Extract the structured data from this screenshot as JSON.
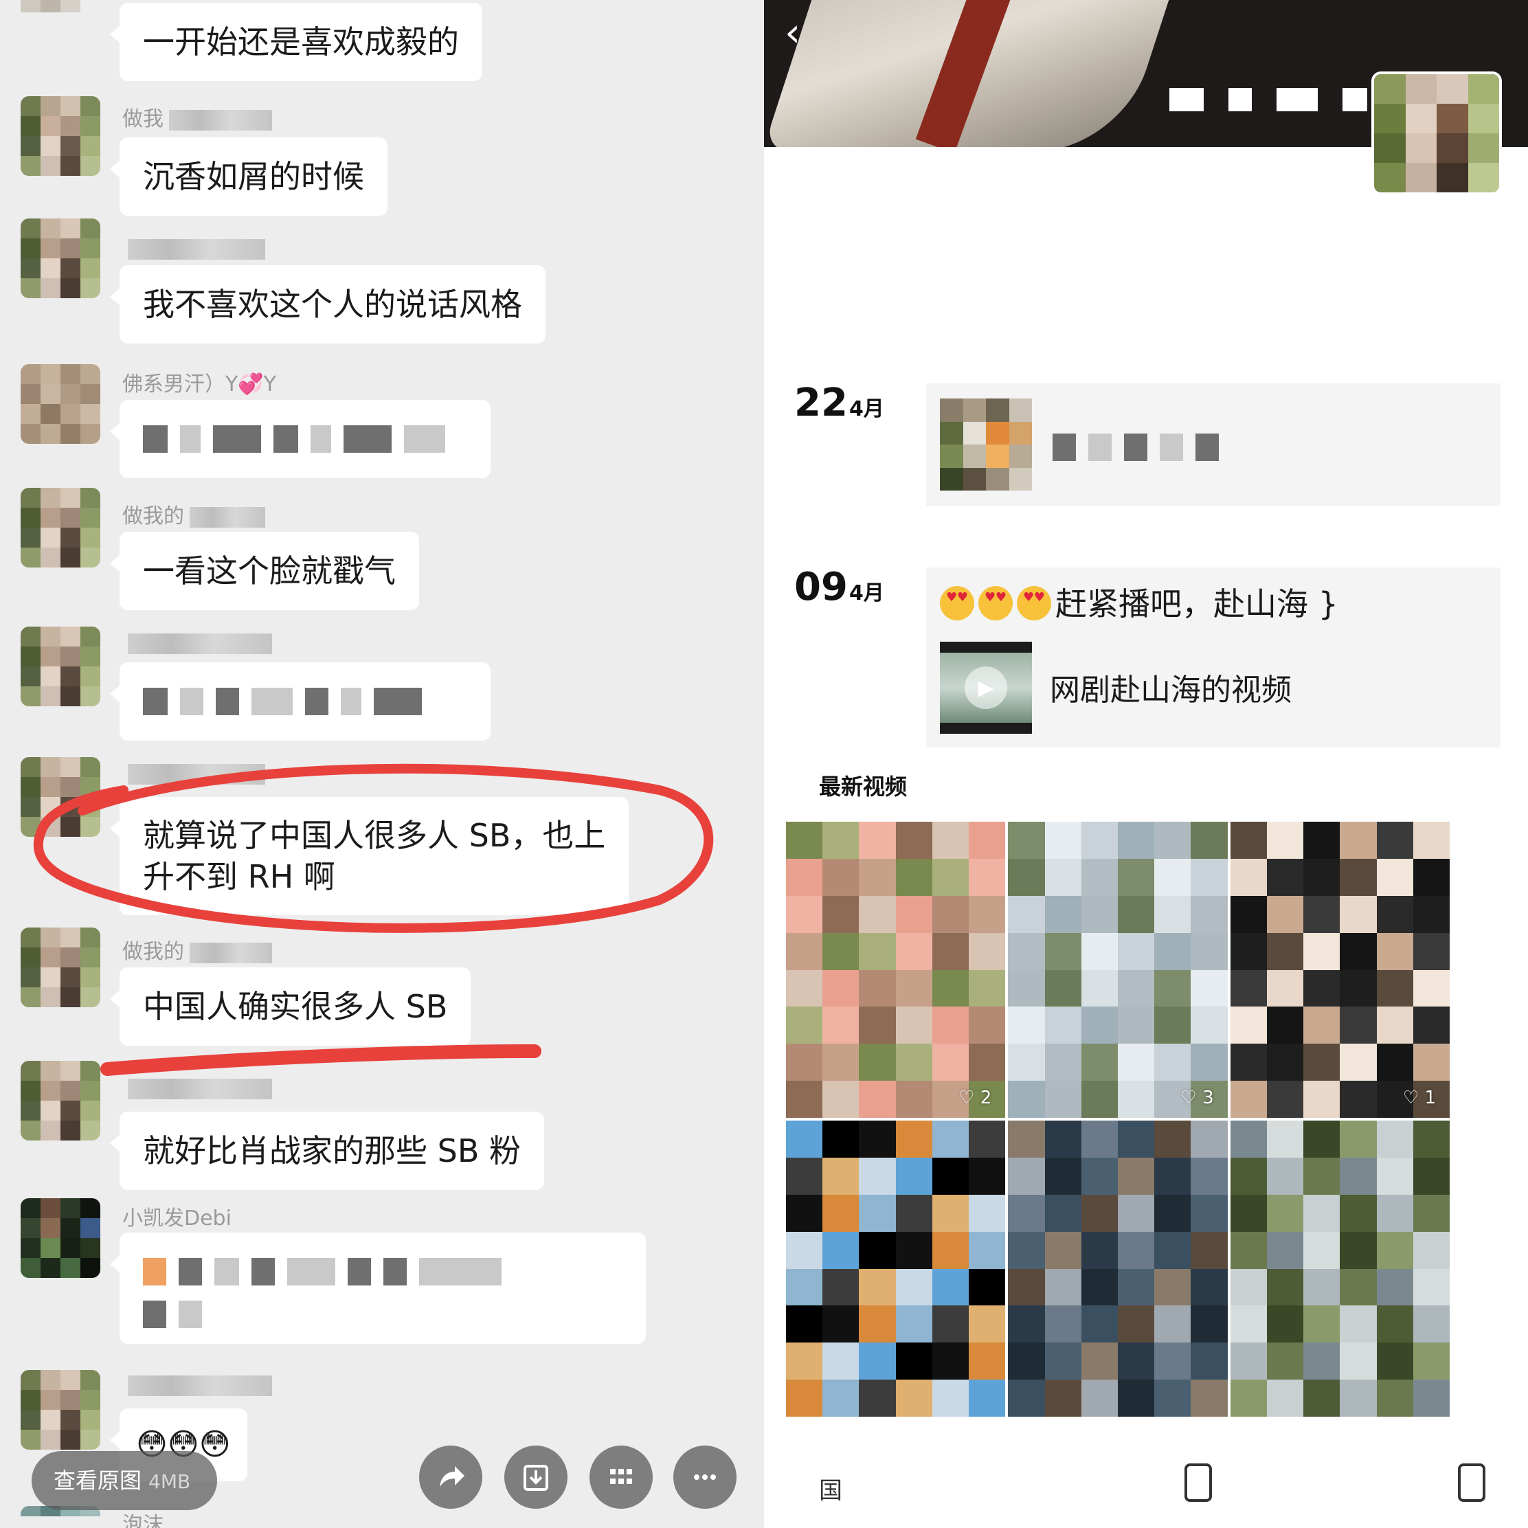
{
  "chat": {
    "messages": [
      {
        "id": "m1",
        "top": 0,
        "nickname": "",
        "text": "一开始还是喜欢成毅的"
      },
      {
        "id": "m2",
        "nickname": "做我",
        "text": "沉香如屑的时候"
      },
      {
        "id": "m3",
        "nickname": "",
        "text": "我不喜欢这个人的说话风格"
      },
      {
        "id": "m4",
        "nickname": "佛系男汗）Y💞Y",
        "text": ""
      },
      {
        "id": "m5",
        "nickname": "做我的",
        "text": "一看这个脸就戳气"
      },
      {
        "id": "m6",
        "nickname": "",
        "text": ""
      },
      {
        "id": "m7",
        "nickname": "",
        "text_line1": "就算说了中国人很多人 SB，也上",
        "text_line2": "升不到 RH 啊"
      },
      {
        "id": "m8",
        "nickname": "做我的",
        "text": "中国人确实很多人 SB"
      },
      {
        "id": "m9",
        "nickname": "",
        "text": "就好比肖战家的那些 SB 粉"
      },
      {
        "id": "m10",
        "nickname": "小凯发Debi",
        "text": ""
      },
      {
        "id": "m11",
        "nickname": "",
        "text": "😳😳😳"
      },
      {
        "id": "m12",
        "nickname": "泡沫",
        "text": ""
      }
    ],
    "view_original_label": "查看原图",
    "view_original_size": "4MB",
    "action_icons": [
      "share-icon",
      "download-icon",
      "grid-icon",
      "more-icon"
    ]
  },
  "profile": {
    "back_icon": "‹",
    "posts": [
      {
        "day": "22",
        "month": "4月",
        "text": ""
      },
      {
        "day": "09",
        "month": "4月",
        "text": "赶紧播吧，赴山海",
        "video_title": "网剧赴山海的视频"
      }
    ],
    "latest_videos_title": "最新视频",
    "videos": [
      {
        "likes": "2"
      },
      {
        "likes": "3"
      },
      {
        "likes": "1"
      },
      {
        "likes": ""
      },
      {
        "likes": ""
      },
      {
        "likes": ""
      }
    ],
    "bottom_label": "国"
  },
  "colors": {
    "chat_bg": "#ededed",
    "bubble": "#ffffff",
    "annotation_red": "#e8413c"
  }
}
